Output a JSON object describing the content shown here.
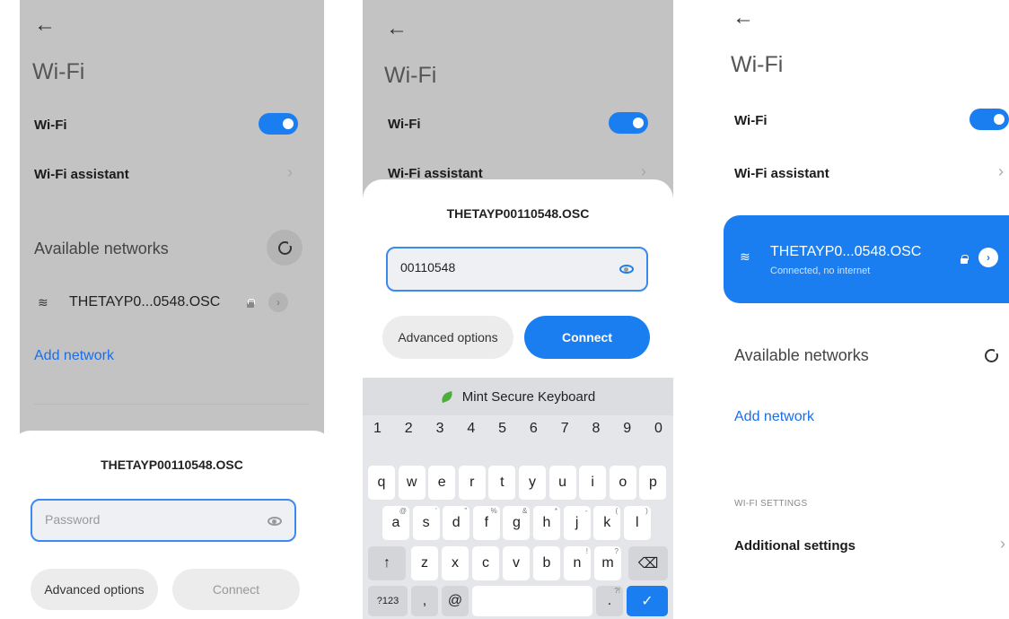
{
  "screen1": {
    "back_icon": "←",
    "title": "Wi-Fi",
    "wifi_label": "Wi-Fi",
    "assistant_label": "Wi-Fi assistant",
    "available_label": "Available networks",
    "network_name": "THETAYP0...0548.OSC",
    "add_network": "Add network",
    "dialog": {
      "title": "THETAYP00110548.OSC",
      "password_placeholder": "Password",
      "advanced_label": "Advanced options",
      "connect_label": "Connect"
    }
  },
  "screen2": {
    "back_icon": "←",
    "title": "Wi-Fi",
    "wifi_label": "Wi-Fi",
    "assistant_label": "Wi-Fi assistant",
    "dialog": {
      "title": "THETAYP00110548.OSC",
      "password_value": "00110548",
      "advanced_label": "Advanced options",
      "connect_label": "Connect"
    },
    "keyboard": {
      "name": "Mint Secure Keyboard",
      "numbers": [
        "1",
        "2",
        "3",
        "4",
        "5",
        "6",
        "7",
        "8",
        "9",
        "0"
      ],
      "row1": [
        "q",
        "w",
        "e",
        "r",
        "t",
        "y",
        "u",
        "i",
        "o",
        "p"
      ],
      "row2": [
        "a",
        "s",
        "d",
        "f",
        "g",
        "h",
        "j",
        "k",
        "l"
      ],
      "row2_hints": [
        "@",
        "'",
        "\"",
        "%",
        "&",
        "*",
        "-",
        "(",
        ")"
      ],
      "row3": [
        "z",
        "x",
        "c",
        "v",
        "b",
        "n",
        "m"
      ],
      "row3_hints": [
        "",
        "",
        "",
        "",
        "",
        "!",
        "?"
      ],
      "shift_icon": "↑",
      "backspace_icon": "⌫",
      "symbols_label": "?123",
      "comma": ",",
      "at": "@",
      "period": ".",
      "period_hint": "?!",
      "enter_icon": "✓"
    }
  },
  "screen3": {
    "back_icon": "←",
    "title": "Wi-Fi",
    "wifi_label": "Wi-Fi",
    "assistant_label": "Wi-Fi assistant",
    "connected_network": {
      "name": "THETAYP0...0548.OSC",
      "status": "Connected, no internet"
    },
    "available_label": "Available networks",
    "add_network": "Add network",
    "settings_header": "WI-FI SETTINGS",
    "additional_settings": "Additional settings"
  },
  "colors": {
    "accent": "#1a7ef0",
    "dim_background": "#c3c3c3"
  }
}
